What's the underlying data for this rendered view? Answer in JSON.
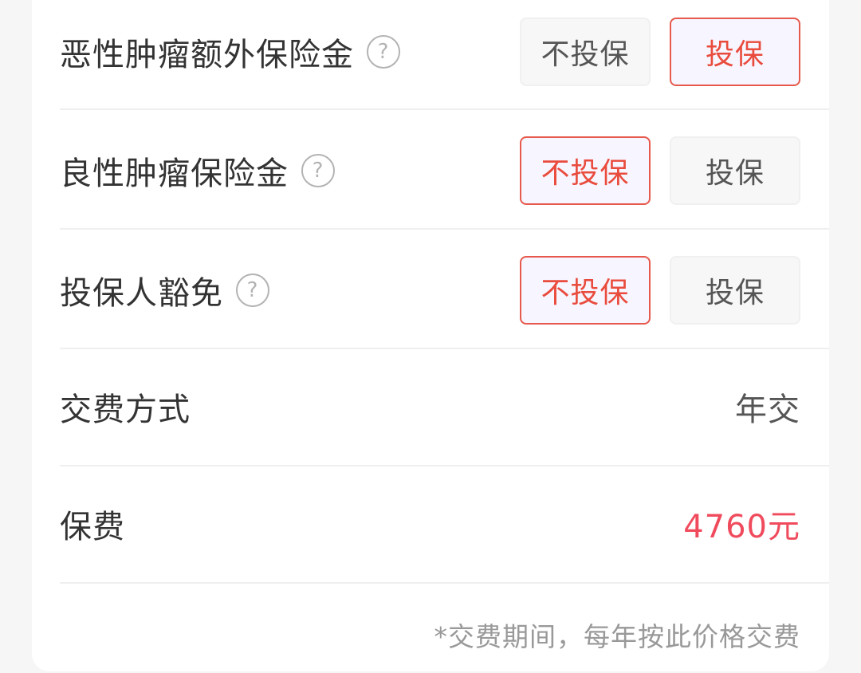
{
  "rows": [
    {
      "label": "恶性肿瘤额外保险金",
      "help": "?",
      "options": [
        {
          "label": "不投保",
          "selected": false
        },
        {
          "label": "投保",
          "selected": true
        }
      ]
    },
    {
      "label": "良性肿瘤保险金",
      "help": "?",
      "options": [
        {
          "label": "不投保",
          "selected": true
        },
        {
          "label": "投保",
          "selected": false
        }
      ]
    },
    {
      "label": "投保人豁免",
      "help": "?",
      "options": [
        {
          "label": "不投保",
          "selected": true
        },
        {
          "label": "投保",
          "selected": false
        }
      ]
    }
  ],
  "payment": {
    "label": "交费方式",
    "value": "年交"
  },
  "premium": {
    "label": "保费",
    "value": "4760元"
  },
  "note": "*交费期间，每年按此价格交费",
  "colors": {
    "accent": "#e94b3c",
    "premium": "#f04b5d",
    "selected_bg": "#f7f5ff",
    "unselected_bg": "#f7f7f7"
  }
}
